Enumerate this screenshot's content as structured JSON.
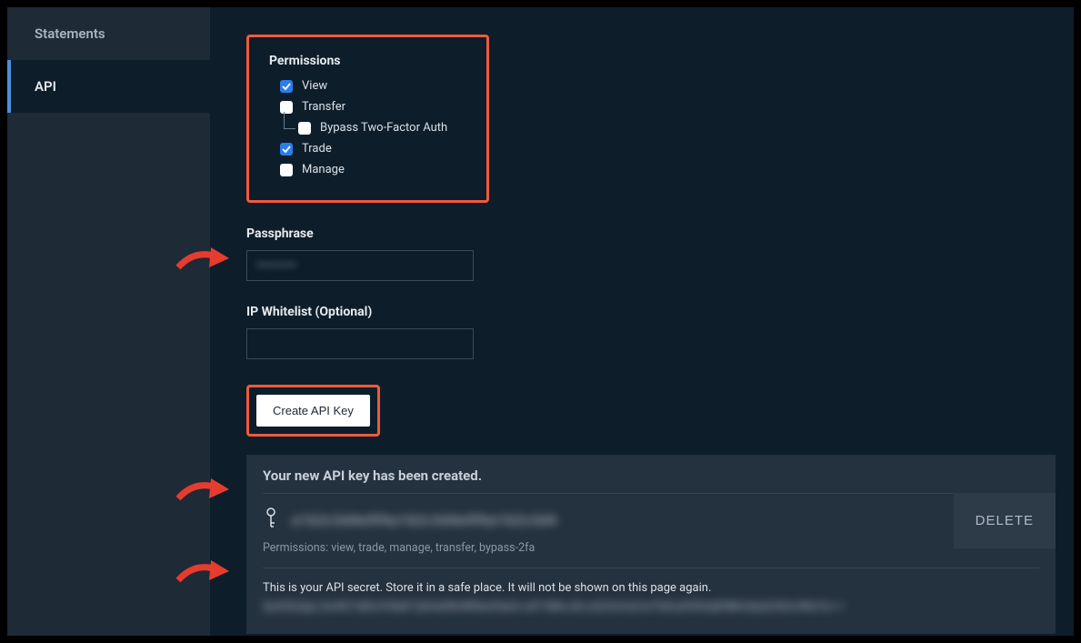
{
  "sidebar": {
    "items": [
      {
        "label": "Statements"
      },
      {
        "label": "API"
      }
    ]
  },
  "permissions": {
    "title": "Permissions",
    "items": {
      "view": {
        "label": "View",
        "checked": true
      },
      "transfer": {
        "label": "Transfer",
        "checked": false
      },
      "bypass2fa": {
        "label": "Bypass Two-Factor Auth",
        "checked": false
      },
      "trade": {
        "label": "Trade",
        "checked": true
      },
      "manage": {
        "label": "Manage",
        "checked": false
      }
    }
  },
  "passphrase": {
    "label": "Passphrase",
    "value": "••••••••••"
  },
  "ipwhitelist": {
    "label": "IP Whitelist (Optional)",
    "value": ""
  },
  "buttons": {
    "create": "Create API Key",
    "delete": "DELETE"
  },
  "result": {
    "title": "Your new API key has been created.",
    "key_blurred": "a1b2c3d4e5f6a1b2c3d4e5f6a1b2c3d4",
    "perm_summary": "Permissions: view, trade, manage, transfer, bypass-2fa",
    "secret_note": "This is your API secret. Store it in a safe place. It will not be shown on this page again.",
    "secret_blurred": "Xy9ZkQpL3mN7vB2cF8dH1jK4sR6tW0eU5aG+oP/iMnJhLzQrSxVyCwTbEuDfGhIjKlMnOpQrStUvWxYz=="
  }
}
